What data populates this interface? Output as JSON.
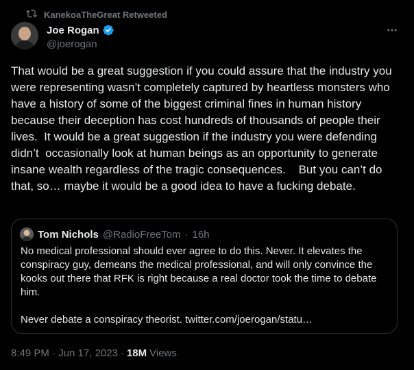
{
  "retweet": {
    "label": "KanekoaTheGreat Retweeted"
  },
  "tweet": {
    "author_name": "Joe Rogan",
    "author_handle": "@joerogan",
    "text": "That would be a great suggestion if you could assure that the industry you were representing wasn’t completely captured by heartless monsters who have a history of some of the biggest criminal fines in human history because their deception has cost hundreds of thousands of people their lives.  It would be a great suggestion if the industry you were defending didn’t  occasionally look at human beings as an opportunity to generate insane wealth regardless of the tragic consequences.    But you can’t do that, so… maybe it would be a good idea to have a fucking debate.",
    "timestamp": "8:49 PM · Jun 17, 2023",
    "views_separator": "·",
    "views_count": "18M",
    "views_label": "Views"
  },
  "quote": {
    "author_name": "Tom Nichols",
    "author_handle": "@RadioFreeTom",
    "separator": "·",
    "age": "16h",
    "text": "No medical professional should ever agree to do this. Never. It elevates the conspiracy guy, demeans the medical professional, and will only convince the kooks out there that RFK is right because a real doctor took the time to debate him.\n\nNever debate a conspiracy theorist. twitter.com/joerogan/statu…"
  },
  "icons": {
    "retweet": "retweet-icon",
    "verified": "verified-badge-icon",
    "more": "more-options-icon"
  },
  "colors": {
    "background": "#000000",
    "text": "#e7e9ea",
    "muted": "#71767b",
    "border": "#2f3336",
    "verified": "#1d9bf0"
  }
}
